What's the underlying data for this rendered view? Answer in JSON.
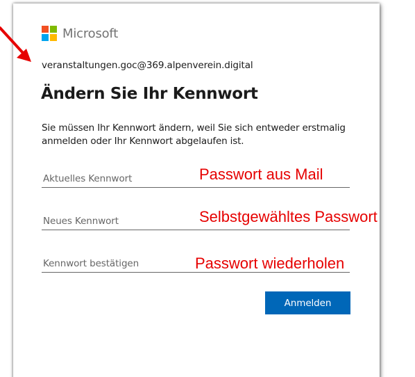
{
  "brand": {
    "name": "Microsoft",
    "colors": [
      "#f25022",
      "#7fba00",
      "#00a4ef",
      "#ffb900"
    ]
  },
  "account": {
    "email": "veranstaltungen.goc@369.alpenverein.digital"
  },
  "page": {
    "title": "Ändern Sie Ihr Kennwort",
    "description": "Sie müssen Ihr Kennwort ändern, weil Sie sich entweder erstmalig anmelden oder Ihr Kennwort abgelaufen ist."
  },
  "form": {
    "current_password_placeholder": "Aktuelles Kennwort",
    "new_password_placeholder": "Neues Kennwort",
    "confirm_password_placeholder": "Kennwort bestätigen",
    "submit_label": "Anmelden",
    "accent_color": "#0067b8"
  },
  "annotations": {
    "current_password_note": "Passwort aus Mail",
    "new_password_note": "Selbstgewähltes Passwort",
    "confirm_password_note": "Passwort wiederholen",
    "color": "#e60000"
  }
}
